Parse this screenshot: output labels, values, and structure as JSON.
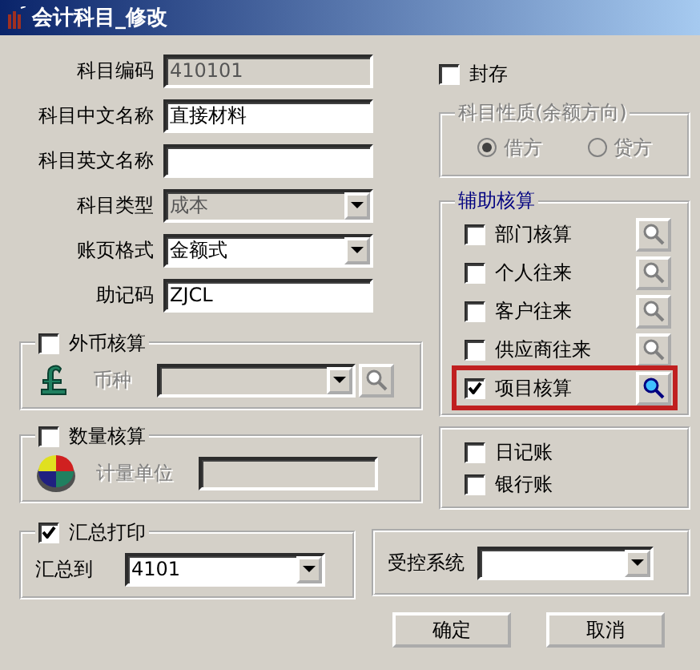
{
  "window": {
    "title": "会计科目_修改"
  },
  "fields": [
    {
      "label": "科目编码",
      "kind": "text",
      "value": "410101",
      "disabled": true
    },
    {
      "label": "科目中文名称",
      "kind": "text",
      "value": "直接材料",
      "disabled": false
    },
    {
      "label": "科目英文名称",
      "kind": "text",
      "disabled": false
    },
    {
      "label": "科目类型",
      "kind": "select",
      "value": "成本",
      "disabled": true
    },
    {
      "label": "账页格式",
      "kind": "select",
      "value": "金额式",
      "disabled": false
    },
    {
      "label": "助记码",
      "kind": "text",
      "value": "ZJCL",
      "disabled": false
    }
  ],
  "foreign_currency": {
    "label": "外币核算",
    "checked": false,
    "field_label": "币种",
    "disabled": true
  },
  "quantity": {
    "label": "数量核算",
    "checked": false,
    "field_label": "计量单位",
    "disabled": true
  },
  "summary_print": {
    "label": "汇总打印",
    "checked": true,
    "field_label": "汇总到",
    "value": "4101"
  },
  "sealed": {
    "label": "封存",
    "checked": false
  },
  "nature": {
    "label": "科目性质(余额方向)",
    "disabled": true,
    "options": [
      {
        "label": "借方",
        "selected": true
      },
      {
        "label": "贷方",
        "selected": false
      }
    ]
  },
  "auxiliary": {
    "label": "辅助核算",
    "items": [
      {
        "label": "部门核算",
        "checked": false,
        "highlighted": false
      },
      {
        "label": "个人往来",
        "checked": false,
        "highlighted": false
      },
      {
        "label": "客户往来",
        "checked": false,
        "highlighted": false
      },
      {
        "label": "供应商往来",
        "checked": false,
        "highlighted": false
      },
      {
        "label": "项目核算",
        "checked": true,
        "highlighted": true
      }
    ]
  },
  "ledgers": [
    {
      "label": "日记账",
      "checked": false
    },
    {
      "label": "银行账",
      "checked": false
    }
  ],
  "controlled_system": {
    "label": "受控系统"
  },
  "buttons": [
    "确定",
    "取消"
  ]
}
